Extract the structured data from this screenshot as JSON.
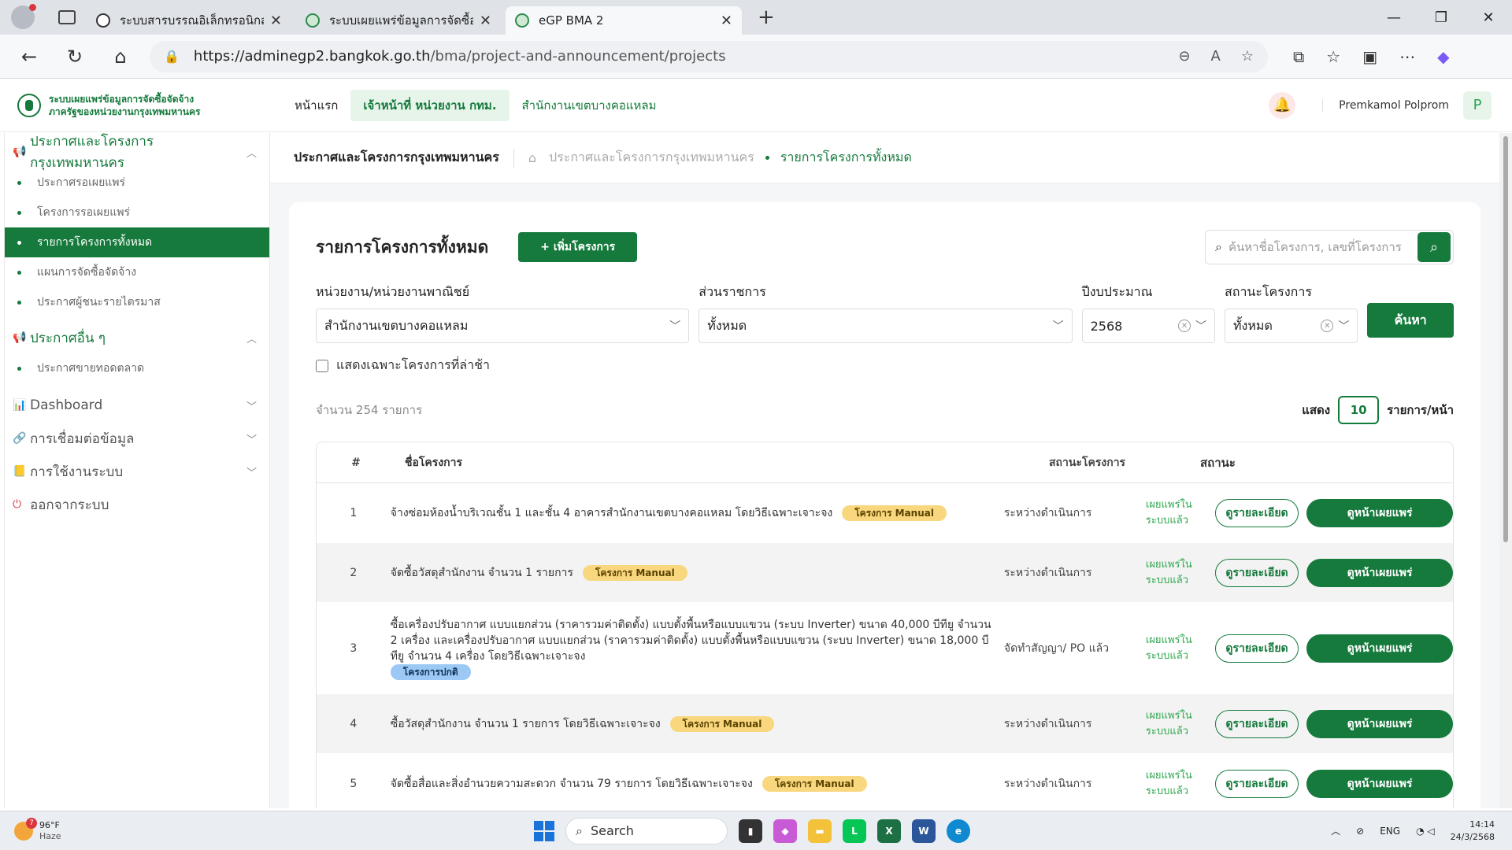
{
  "browser": {
    "tabs": [
      {
        "title": "ระบบสารบรรณอิเล็กทรอนิกส์ของกรุงเทพ"
      },
      {
        "title": "ระบบเผยแพร่ข้อมูลการจัดซื้อจัดจ้างภาค"
      },
      {
        "title": "eGP BMA 2"
      }
    ],
    "url_host": "https://adminegp2.bangkok.go.th",
    "url_path": "/bma/project-and-announcement/projects"
  },
  "app": {
    "logo_line1": "ระบบเผยแพร่ข้อมูลการจัดซื้อจัดจ้าง",
    "logo_line2": "ภาครัฐของหน่วยงานกรุงเทพมหานคร",
    "nav": [
      "หน้าแรก",
      "เจ้าหน้าที่ หน่วยงาน กทม.",
      "สำนักงานเขตบางคอแหลม"
    ],
    "user_name": "Premkamol Polprom",
    "user_initial": "P"
  },
  "sidebar": {
    "group1": "ประกาศและโครงการกรุงเทพมหานคร",
    "group1_items": [
      "ประกาศรอเผยแพร่",
      "โครงการรอเผยแพร่",
      "รายการโครงการทั้งหมด",
      "แผนการจัดซื้อจัดจ้าง",
      "ประกาศผู้ชนะรายไตรมาส"
    ],
    "group2": "ประกาศอื่น ๆ",
    "group2_items": [
      "ประกาศขายทอดตลาด"
    ],
    "dashboard": "Dashboard",
    "integration": "การเชื่อมต่อข้อมูล",
    "usage": "การใช้งานระบบ",
    "logout": "ออกจากระบบ"
  },
  "breadcrumb": {
    "page_title": "ประกาศและโครงการกรุงเทพมหานคร",
    "level1": "ประกาศและโครงการกรุงเทพมหานคร",
    "current": "รายการโครงการทั้งหมด"
  },
  "main": {
    "card_title": "รายการโครงการทั้งหมด",
    "add_button": "+ เพิ่มโครงการ",
    "search_placeholder": "ค้นหาชื่อโครงการ, เลขที่โครงการ",
    "filters": {
      "agency_label": "หน่วยงาน/หน่วยงานพาณิชย์",
      "agency_value": "สำนักงานเขตบางคอแหลม",
      "division_label": "ส่วนราชการ",
      "division_value": "ทั้งหมด",
      "year_label": "ปีงบประมาณ",
      "year_value": "2568",
      "status_label": "สถานะโครงการ",
      "status_value": "ทั้งหมด",
      "search_button": "ค้นหา"
    },
    "late_only_label": "แสดงเฉพาะโครงการที่ล่าช้า",
    "count_text": "จำนวน  254  รายการ",
    "show_label": "แสดง",
    "per_page": "10",
    "per_page_suffix": "รายการ/หน้า",
    "columns": [
      "#",
      "ชื่อโครงการ",
      "สถานะโครงการ",
      "สถานะ"
    ],
    "rows": [
      {
        "num": "1",
        "name": "จ้างซ่อมห้องน้ำบริเวณชั้น 1 และชั้น 4 อาคารสำนักงานเขตบางคอแหลม โดยวิธีเฉพาะเจาะจง",
        "tag": "โครงการ Manual",
        "status": "ระหว่างดำเนินการ",
        "publish": "เผยแพร่ในระบบแล้ว"
      },
      {
        "num": "2",
        "name": "จัดซื้อวัสดุสำนักงาน จำนวน 1 รายการ",
        "tag": "โครงการ Manual",
        "status": "ระหว่างดำเนินการ",
        "publish": "เผยแพร่ในระบบแล้ว"
      },
      {
        "num": "3",
        "name": "ซื้อเครื่องปรับอากาศ แบบแยกส่วน (ราคารวมค่าติดตั้ง) แบบตั้งพื้นหรือแบบแขวน (ระบบ Inverter) ขนาด 40,000 บีทียู จำนวน 2 เครื่อง และเครื่องปรับอากาศ แบบแยกส่วน (ราคารวมค่าติดตั้ง) แบบตั้งพื้นหรือแบบแขวน (ระบบ Inverter) ขนาด 18,000 บีทียู จำนวน 4 เครื่อง โดยวิธีเฉพาะเจาะจง",
        "tag": "โครงการปกติ",
        "status": "จัดทำสัญญา/ PO แล้ว",
        "publish": "เผยแพร่ในระบบแล้ว"
      },
      {
        "num": "4",
        "name": "ซื้อวัสดุสำนักงาน จำนวน 1 รายการ โดยวิธีเฉพาะเจาะจง",
        "tag": "โครงการ Manual",
        "status": "ระหว่างดำเนินการ",
        "publish": "เผยแพร่ในระบบแล้ว"
      },
      {
        "num": "5",
        "name": "จัดซื้อสื่อและสิ่งอำนวยความสะดวก จำนวน 79 รายการ โดยวิธีเฉพาะเจาะจง",
        "tag": "โครงการ Manual",
        "status": "ระหว่างดำเนินการ",
        "publish": "เผยแพร่ในระบบแล้ว"
      }
    ],
    "detail_button": "ดูรายละเอียด",
    "view_page_button": "ดูหน้าเผยแพร่"
  },
  "taskbar": {
    "temp": "96°F",
    "weather": "Haze",
    "weather_badge": "7",
    "search": "Search",
    "lang": "ENG",
    "time": "14:14",
    "date": "24/3/2568"
  },
  "colors": {
    "brand": "#157a3c",
    "manual_tag": "#f8d77e",
    "normal_tag": "#9cc8f5"
  }
}
